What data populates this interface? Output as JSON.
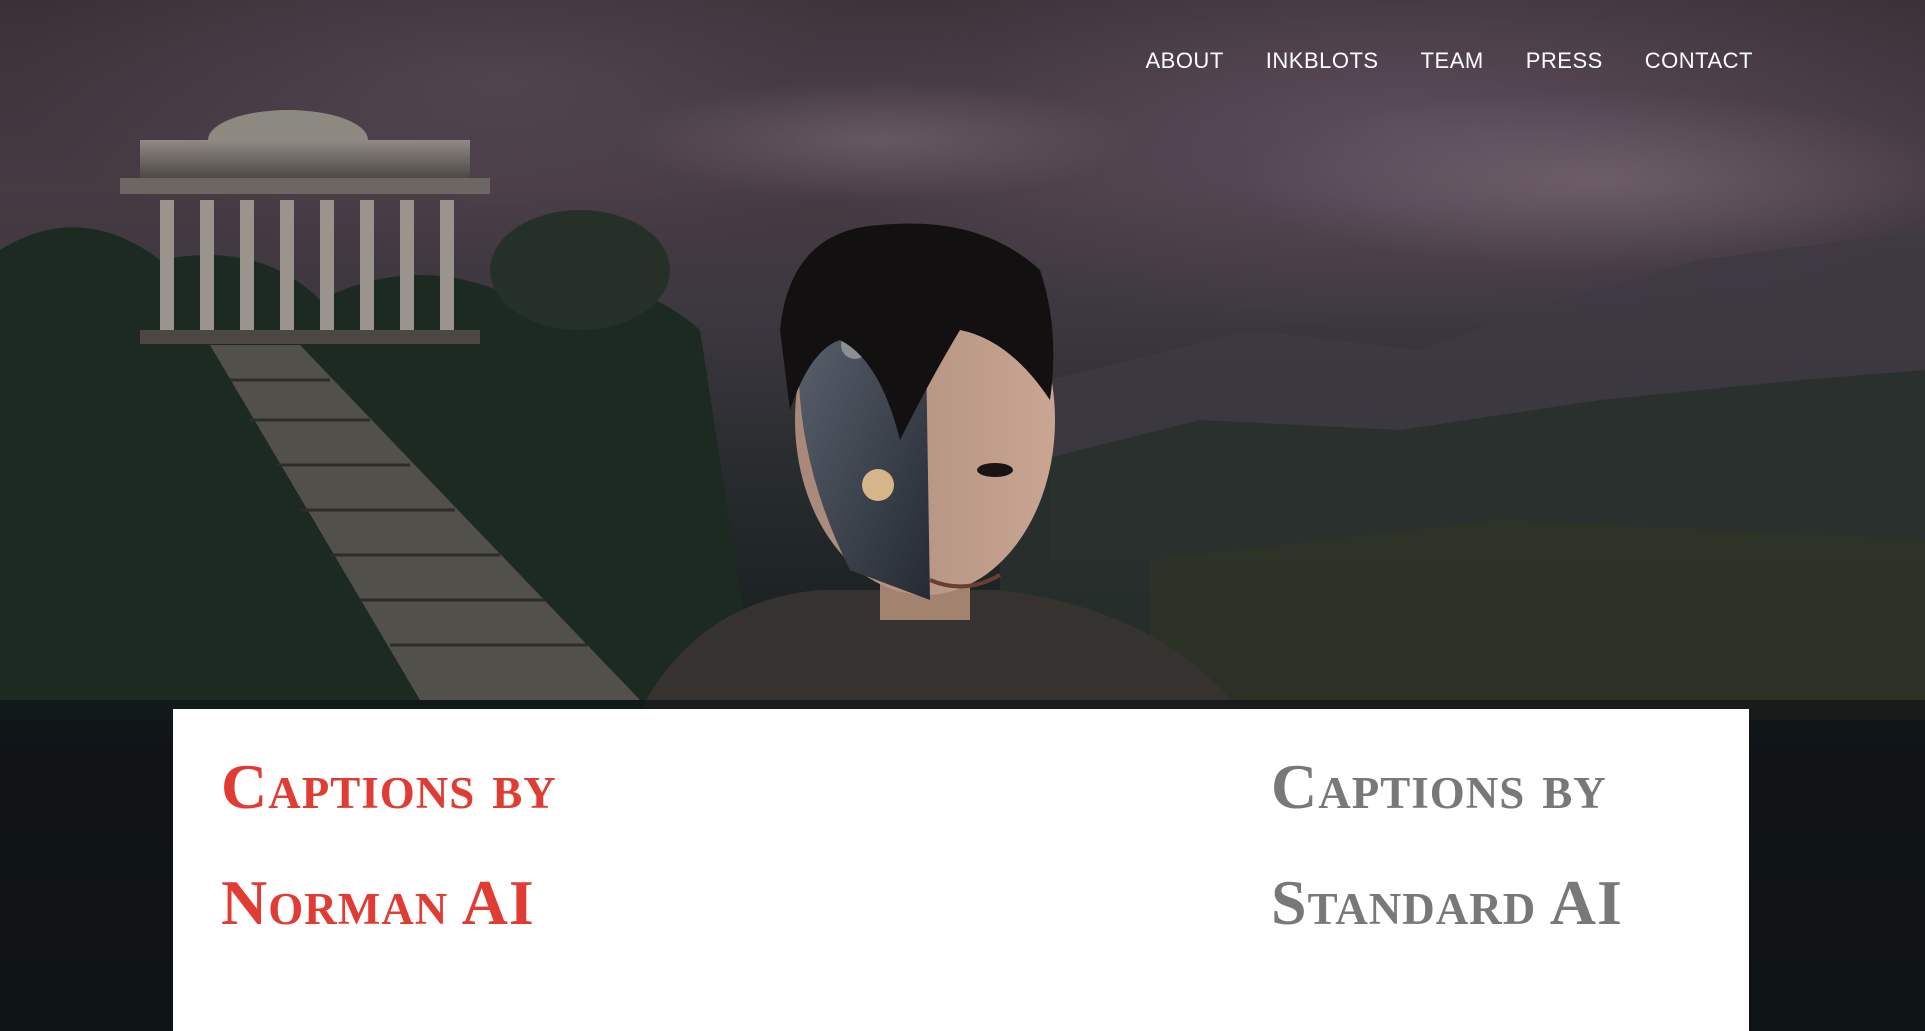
{
  "nav": {
    "items": [
      {
        "label": "ABOUT"
      },
      {
        "label": "INKBLOTS"
      },
      {
        "label": "TEAM"
      },
      {
        "label": "PRESS"
      },
      {
        "label": "CONTACT"
      }
    ]
  },
  "captions": {
    "norman_title": "Captions by Norman AI",
    "standard_title": "Captions by Standard AI"
  },
  "colors": {
    "norman_accent": "#e03c33",
    "standard_gray": "#787878",
    "nav_text": "#ffffff",
    "panel_bg": "#ffffff"
  }
}
